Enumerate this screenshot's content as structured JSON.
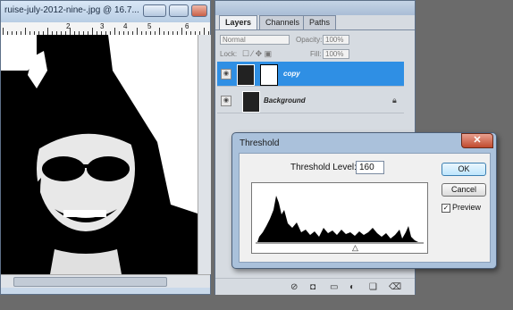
{
  "document": {
    "title": "ruise-july-2012-nine-.jpg @ 16.7...",
    "ruler_numbers": [
      "2",
      "3",
      "4",
      "5",
      "6"
    ]
  },
  "layers_panel": {
    "tabs": [
      "Layers",
      "Channels",
      "Paths"
    ],
    "blend_mode": "Normal",
    "opacity_label": "Opacity:",
    "opacity_value": "100%",
    "lock_label": "Lock:",
    "fill_label": "Fill:",
    "fill_value": "100%",
    "layers": [
      {
        "name": "copy",
        "selected": true
      },
      {
        "name": "Background",
        "selected": false
      }
    ]
  },
  "threshold_dialog": {
    "title": "Threshold",
    "level_label": "Threshold Level:",
    "level_value": "160",
    "ok_label": "OK",
    "cancel_label": "Cancel",
    "preview_label": "Preview",
    "preview_checked": true
  },
  "colors": {
    "selected_layer": "#2f8fe4",
    "close_button": "#c04a2e"
  }
}
